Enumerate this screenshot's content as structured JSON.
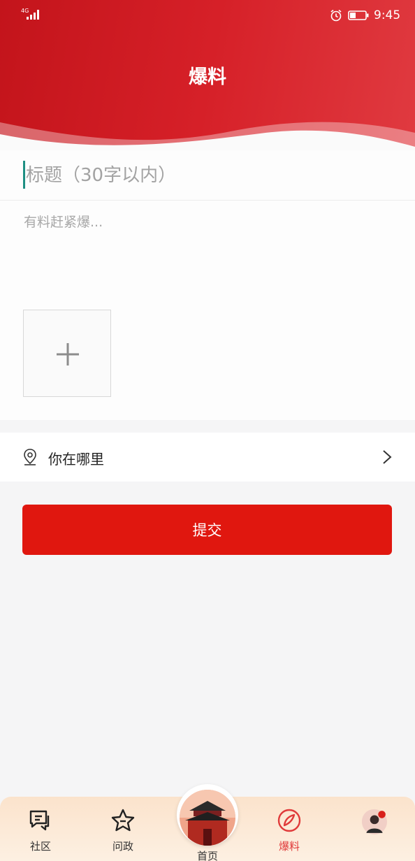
{
  "status_bar": {
    "network": "4G",
    "time": "9:45"
  },
  "header": {
    "title": "爆料"
  },
  "form": {
    "title_placeholder": "标题（30字以内）",
    "body_placeholder": "有料赶紧爆..."
  },
  "location": {
    "label": "你在哪里"
  },
  "submit": {
    "label": "提交"
  },
  "tabbar": {
    "tabs": [
      {
        "label": "社区",
        "icon": "community-icon"
      },
      {
        "label": "问政",
        "icon": "star-icon"
      },
      {
        "label": "首页",
        "icon": "home-building-icon"
      },
      {
        "label": "爆料",
        "icon": "tipoff-icon",
        "active": true
      },
      {
        "label": "",
        "icon": "profile-avatar-icon"
      }
    ]
  },
  "colors": {
    "brand_red": "#d62028",
    "submit_red": "#e0170f",
    "active_tab": "#e03a3a",
    "cursor": "#1f8f83"
  }
}
